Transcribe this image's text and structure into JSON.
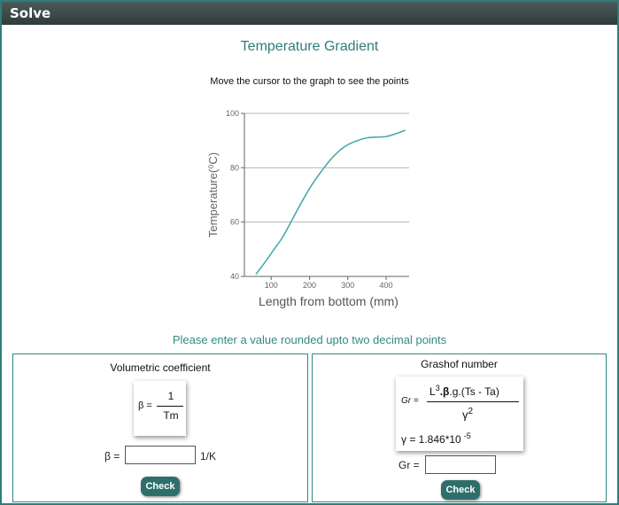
{
  "window": {
    "title": "Solve"
  },
  "page": {
    "heading": "Temperature Gradient",
    "instruction": "Move the cursor to the graph to see the points",
    "prompt": "Please enter a value rounded upto two decimal points"
  },
  "chart_data": {
    "type": "line",
    "title": "",
    "xlabel": "Length from bottom (mm)",
    "ylabel": "Temperature(⁰C)",
    "xlim": [
      30,
      460
    ],
    "ylim": [
      40,
      100
    ],
    "xticks": [
      100,
      200,
      300,
      400
    ],
    "yticks": [
      40,
      60,
      80,
      100
    ],
    "grid": "horizontal",
    "color": "#4aa9ad",
    "series": [
      {
        "x": [
          60,
          80,
          105,
          130,
          155,
          180,
          205,
          230,
          255,
          280,
          300,
          325,
          350,
          380,
          400,
          425,
          450
        ],
        "y": [
          40.8,
          44.5,
          49.5,
          54.5,
          61,
          67.5,
          73.5,
          78.5,
          83,
          86.5,
          88.5,
          90,
          91,
          91.3,
          91.5,
          92.5,
          93.8
        ]
      }
    ]
  },
  "left_panel": {
    "title": "Volumetric coefficient",
    "formula": {
      "lhs": "β =",
      "numerator": "1",
      "denominator": "Tm"
    },
    "input_label": "β =",
    "input_value": "",
    "unit": "1/K",
    "check_label": "Check"
  },
  "right_panel": {
    "title": "Grashof number",
    "formula": {
      "lhs": "Gr =",
      "numerator_pre": "L",
      "numerator_sup": "3",
      "numerator_bold": ".β",
      "numerator_post": ".g.(Ts - Ta)",
      "denominator": "γ",
      "denominator_sup": "2",
      "gamma_text": "γ = 1.846*10",
      "gamma_sup": "-5"
    },
    "input_label": "Gr =",
    "input_value": "",
    "check_label": "Check"
  }
}
